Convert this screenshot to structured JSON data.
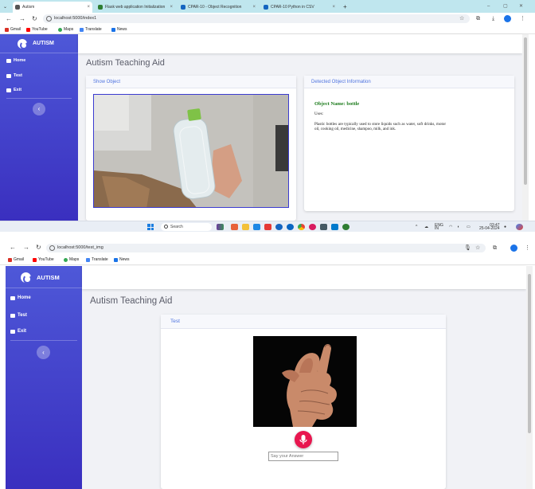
{
  "browser1": {
    "tabs": [
      {
        "label": "Autism",
        "active": true,
        "color": "#555555"
      },
      {
        "label": "Flask web application Initialization",
        "active": false,
        "color": "#2e7d32"
      },
      {
        "label": "CPAR-10 - Object Recognition",
        "active": false,
        "color": "#1565c0"
      },
      {
        "label": "CPAR-10 Python in CSV",
        "active": false,
        "color": "#1565c0"
      }
    ],
    "url": "localhost:5000/index1"
  },
  "browser2": {
    "url": "localhost:5000/test_img"
  },
  "bookmarks": [
    {
      "label": "Gmail",
      "color": "#d93025"
    },
    {
      "label": "YouTube",
      "color": "#ff0000"
    },
    {
      "label": "Maps",
      "color": "#34a853"
    },
    {
      "label": "Translate",
      "color": "#4285f4"
    },
    {
      "label": "News",
      "color": "#1a73e8"
    }
  ],
  "sidebar": {
    "brand": "AUTISM",
    "items": [
      {
        "label": "Home",
        "icon": "home-icon"
      },
      {
        "label": "Test",
        "icon": "table-icon"
      },
      {
        "label": "Exit",
        "icon": "table-icon"
      }
    ],
    "toggle": "‹"
  },
  "page1": {
    "title": "Autism Teaching Aid",
    "show_card": {
      "header": "Show Object"
    },
    "info_card": {
      "header": "Detected Object Information",
      "object_name": "Object Name: bottle",
      "uses_label": "Uses:",
      "uses_text": "Plastic bottles are typically used to store liquids such as water, soft drinks, motor oil, cooking oil, medicine, shampoo, milk, and ink."
    }
  },
  "page2": {
    "title": "Autism Teaching Aid",
    "test_card": {
      "header": "Test",
      "answer_placeholder": "Say your Answer"
    }
  },
  "taskbar": {
    "search": "Search",
    "weather_temp": "27°C",
    "weather_label": "IN",
    "lang": "ENG",
    "time": "03:47",
    "date": "25-04-2024"
  },
  "colors": {
    "sidebar_top": "#4e58d8",
    "sidebar_bottom": "#3a2fbf",
    "accent": "#4e73df",
    "object_name": "#1a7a1a",
    "mic_button": "#e8164f"
  }
}
